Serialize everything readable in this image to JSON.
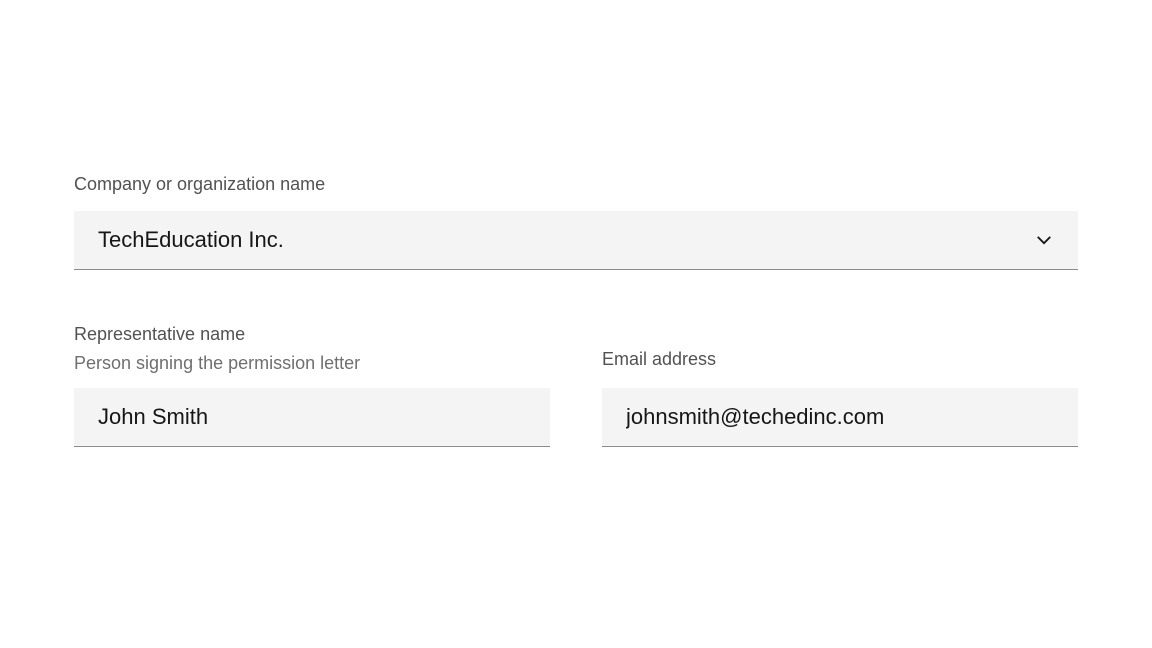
{
  "form": {
    "company": {
      "label": "Company or organization name",
      "selected": "TechEducation Inc."
    },
    "representative": {
      "label": "Representative name",
      "helper": "Person signing the permission letter",
      "value": "John Smith"
    },
    "email": {
      "label": "Email address",
      "value": "johnsmith@techedinc.com"
    }
  }
}
